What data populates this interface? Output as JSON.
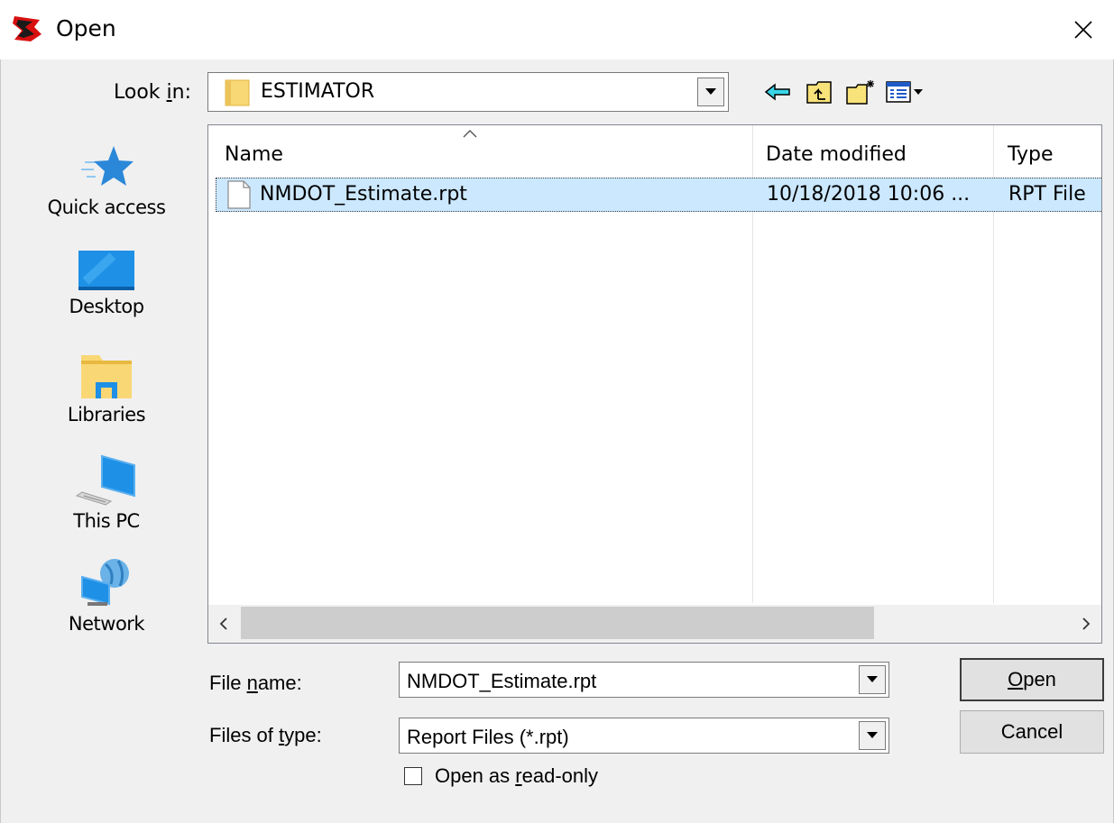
{
  "window": {
    "title": "Open"
  },
  "lookin": {
    "label_pre": "Look ",
    "label_key": "i",
    "label_post": "n:",
    "value": "ESTIMATOR"
  },
  "toolbar": {
    "icons": [
      "back-arrow-icon",
      "up-folder-icon",
      "new-folder-icon",
      "view-menu-icon"
    ]
  },
  "places": [
    {
      "label": "Quick access",
      "icon": "star-icon"
    },
    {
      "label": "Desktop",
      "icon": "desktop-icon"
    },
    {
      "label": "Libraries",
      "icon": "libraries-icon"
    },
    {
      "label": "This PC",
      "icon": "computer-icon"
    },
    {
      "label": "Network",
      "icon": "network-icon"
    }
  ],
  "filelist": {
    "columns": [
      "Name",
      "Date modified",
      "Type"
    ],
    "rows": [
      {
        "name": "NMDOT_Estimate.rpt",
        "date": "10/18/2018 10:06 ...",
        "type": "RPT File"
      }
    ]
  },
  "filename": {
    "label_pre": "File ",
    "label_key": "n",
    "label_post": "ame:",
    "value": "NMDOT_Estimate.rpt"
  },
  "filetype": {
    "label_pre": "Files of ",
    "label_key": "t",
    "label_post": "ype:",
    "value": "Report Files (*.rpt)"
  },
  "buttons": {
    "open_key": "O",
    "open_rest": "pen",
    "cancel": "Cancel"
  },
  "readonly": {
    "label_pre": "Open as ",
    "label_key": "r",
    "label_post": "ead-only",
    "checked": false
  },
  "colors": {
    "selection": "#cce8ff",
    "folder": "#f8d775",
    "accent": "#0078d7"
  }
}
